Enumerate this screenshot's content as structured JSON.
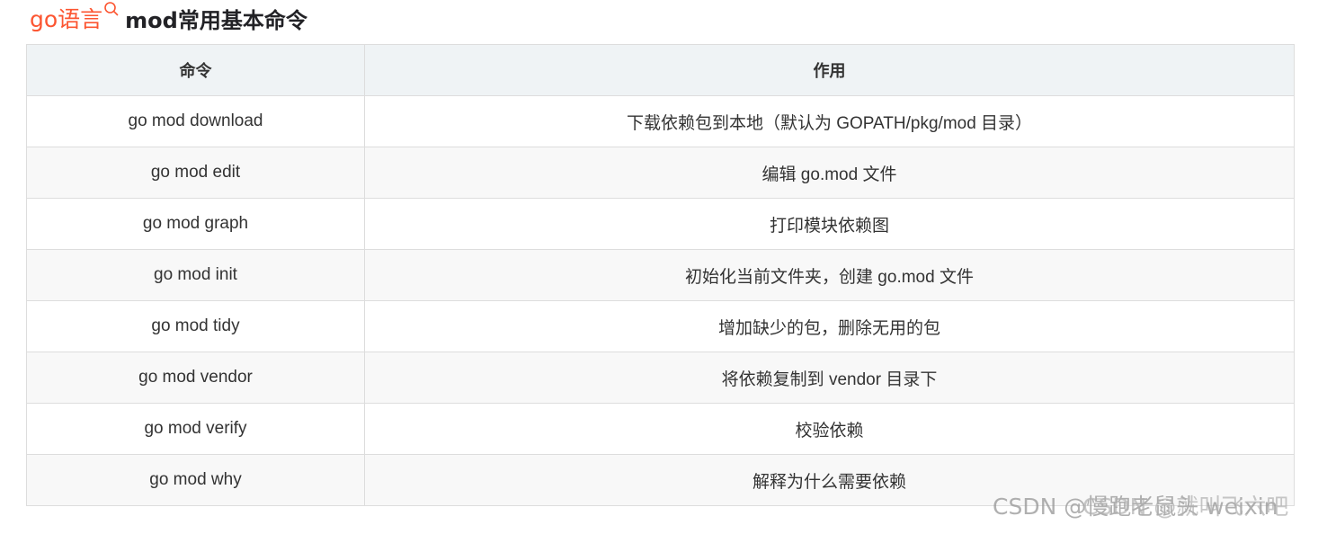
{
  "heading": {
    "link_text": "go语言",
    "link_icon": "search-icon",
    "text": "mod常用基本命令",
    "link_color": "#fc5531"
  },
  "table": {
    "headers": [
      "命令",
      "作用"
    ],
    "rows": [
      [
        "go mod download",
        "下载依赖包到本地（默认为 GOPATH/pkg/mod 目录）"
      ],
      [
        "go mod edit",
        "编辑 go.mod 文件"
      ],
      [
        "go mod graph",
        "打印模块依赖图"
      ],
      [
        "go mod init",
        "初始化当前文件夹，创建 go.mod 文件"
      ],
      [
        "go mod tidy",
        "增加缺少的包，删除无用的包"
      ],
      [
        "go mod vendor",
        "将依赖复制到 vendor 目录下"
      ],
      [
        "go mod verify",
        "校验依赖"
      ],
      [
        "go mod why",
        "解释为什么需要依赖"
      ]
    ]
  },
  "watermark": {
    "line1": "CSDN @慢跑老鼠头 weixin",
    "line2": "CSDN @就叫飞六吧"
  }
}
